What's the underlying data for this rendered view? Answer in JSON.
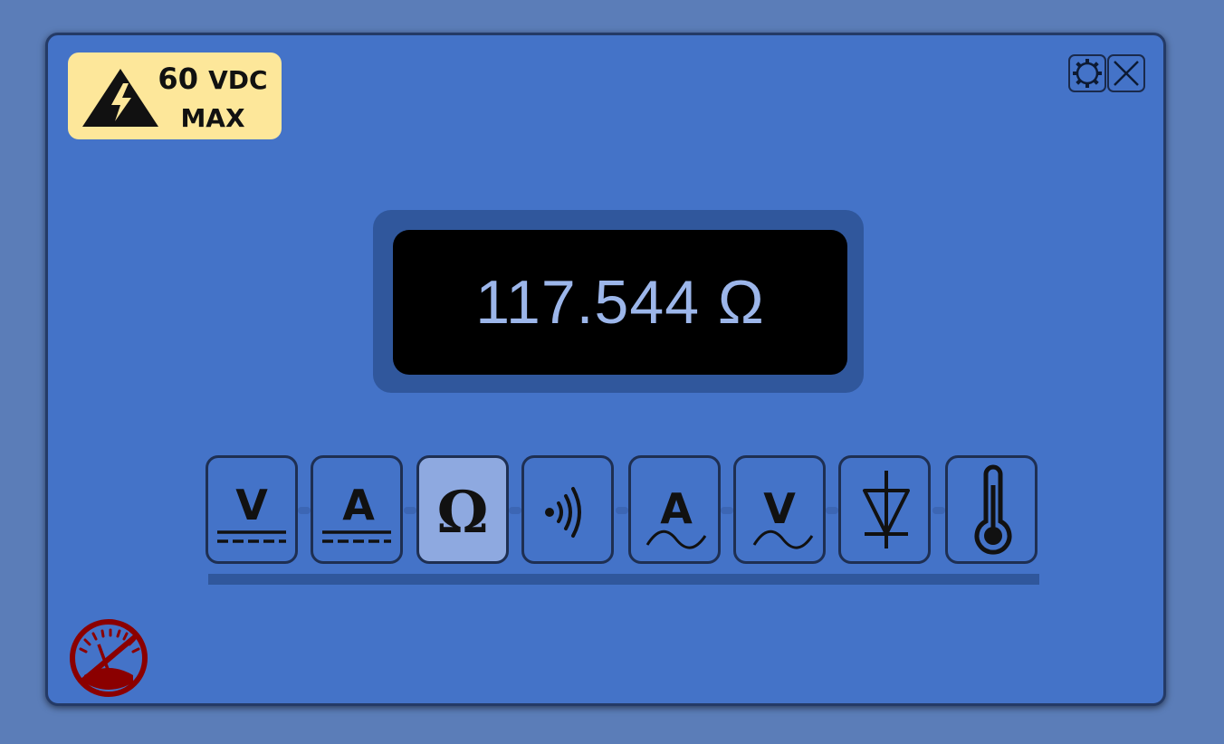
{
  "warning": {
    "voltage": "60",
    "unit": "VDC",
    "limit": "MAX"
  },
  "display": {
    "reading": "117.544 Ω"
  },
  "modes": [
    {
      "id": "dc-voltage",
      "letter": "V",
      "active": false
    },
    {
      "id": "dc-current",
      "letter": "A",
      "active": false
    },
    {
      "id": "resistance",
      "symbol": "Ω",
      "active": true
    },
    {
      "id": "continuity",
      "active": false
    },
    {
      "id": "ac-current",
      "letter": "A",
      "active": false
    },
    {
      "id": "ac-voltage",
      "letter": "V",
      "active": false
    },
    {
      "id": "diode",
      "active": false
    },
    {
      "id": "temperature",
      "active": false
    }
  ],
  "colors": {
    "background": "#5b7db8",
    "panel": "#4473c8",
    "bezel": "#30579c",
    "active_button": "#8ea9e0",
    "display_text": "#9cb6ea",
    "warning_bg": "#fde79a",
    "gauge": "#8b0000"
  },
  "icons": {
    "warning": "high-voltage-warning-icon",
    "settings": "gear-icon",
    "close": "close-icon",
    "gauge": "disabled-gauge-icon"
  }
}
